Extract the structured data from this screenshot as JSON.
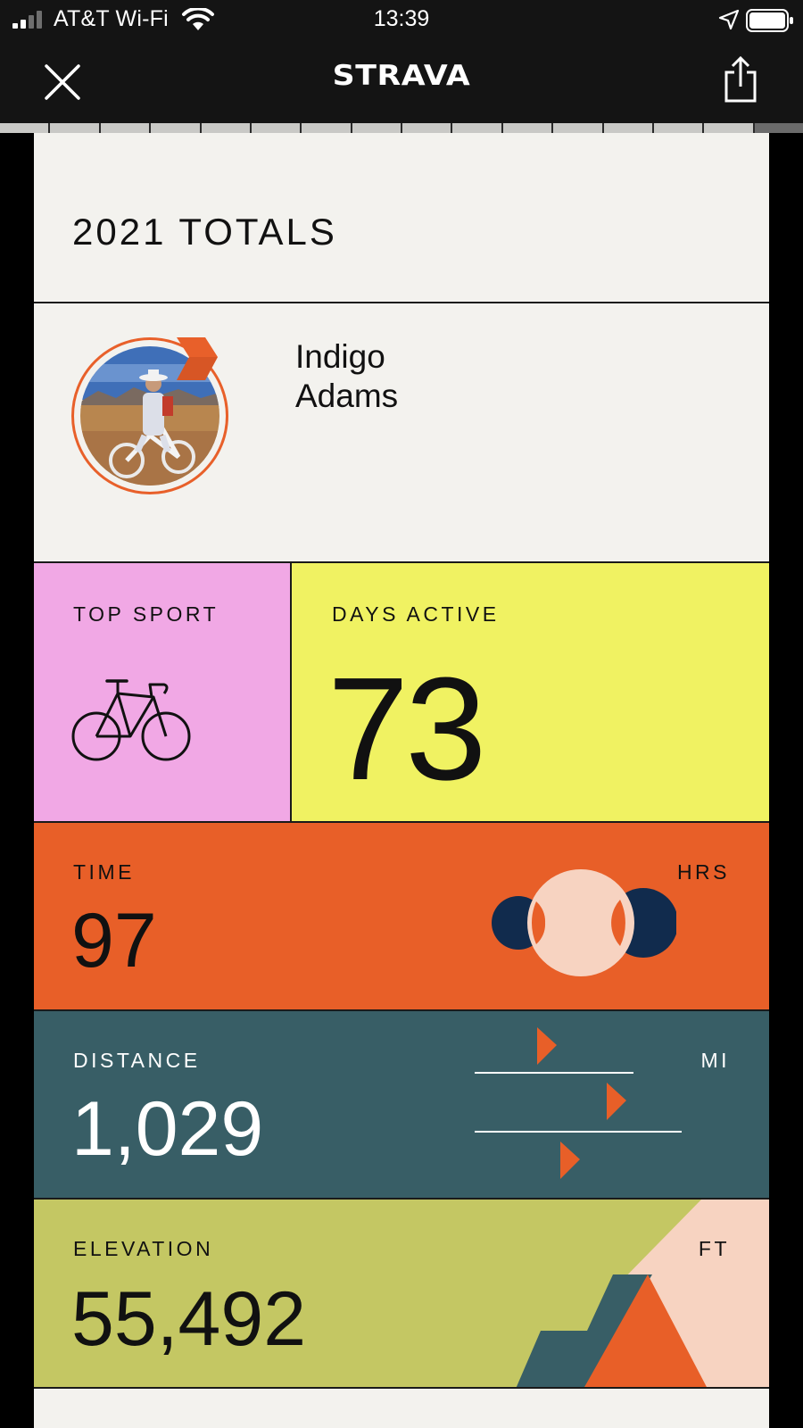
{
  "status_bar": {
    "carrier": "AT&T Wi-Fi",
    "time": "13:39",
    "icons": [
      "signal-icon",
      "wifi-icon",
      "location-icon",
      "battery-icon"
    ]
  },
  "nav": {
    "logo": "STRAVA",
    "close_icon": "close-icon",
    "share_icon": "share-icon"
  },
  "progress": {
    "segments": 16,
    "completed": 15,
    "current_fraction": 0.5
  },
  "card": {
    "title": "2021 TOTALS",
    "athlete": {
      "name": "Indigo\nAdams",
      "avatar_icon": "cyclist-photo"
    },
    "top_sport": {
      "label": "TOP SPORT",
      "icon": "bike-icon"
    },
    "days_active": {
      "label": "DAYS ACTIVE",
      "value": "73"
    },
    "time": {
      "label": "TIME",
      "value": "97",
      "unit": "HRS"
    },
    "distance": {
      "label": "DISTANCE",
      "value": "1,029",
      "unit": "MI"
    },
    "elevation": {
      "label": "ELEVATION",
      "value": "55,492",
      "unit": "FT"
    }
  },
  "colors": {
    "pink": "#f1a8e5",
    "yellow": "#f0f262",
    "orange": "#e85f28",
    "teal": "#385e66",
    "olive": "#c4c763",
    "navy": "#112b4d",
    "peach": "#f7d3c1"
  }
}
